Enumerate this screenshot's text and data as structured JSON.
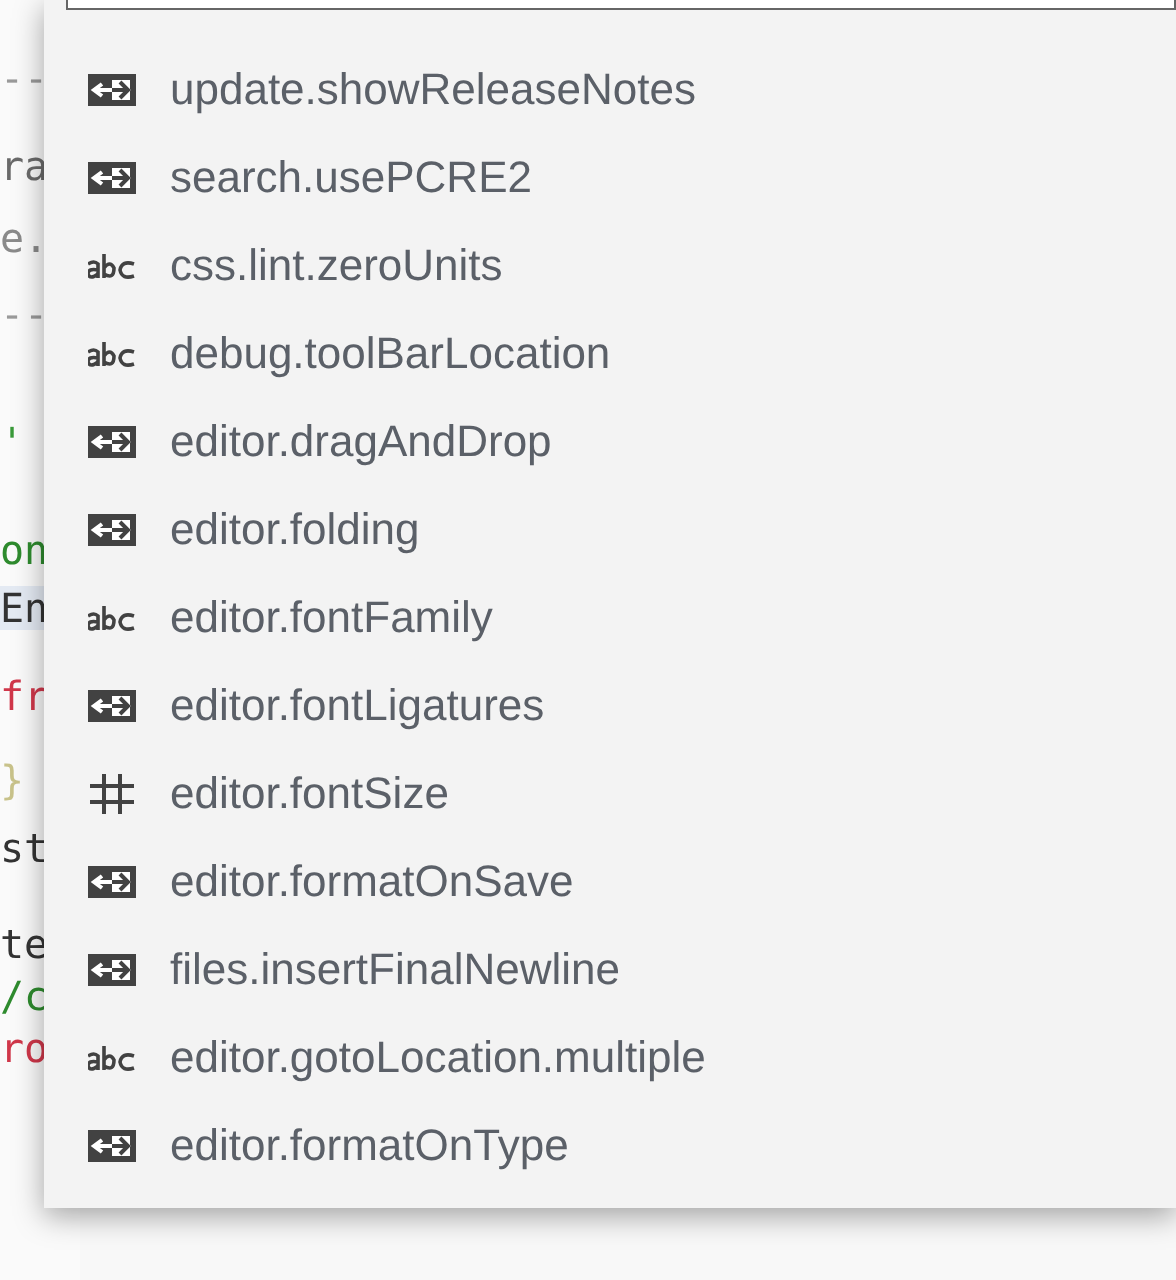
{
  "editor_lines": [
    {
      "text": "--",
      "color": "#9a9a9a"
    },
    {
      "text": "ra",
      "color": "#6a6a6a"
    },
    {
      "text": "e.",
      "color": "#8a8a8a"
    },
    {
      "text": "--",
      "color": "#9a9a9a"
    },
    {
      "text": "'",
      "color": "#3a9a3a"
    },
    {
      "text": "on",
      "color": "#2e8b2e"
    },
    {
      "text": "En",
      "color": "#333333",
      "selected": true
    },
    {
      "text": "fr",
      "color": "#d0374a",
      "selected": false
    },
    {
      "text": "}",
      "color": "#c8c28a"
    },
    {
      "text": "st",
      "color": "#333333"
    },
    {
      "text": "te",
      "color": "#333333"
    },
    {
      "text": "/c",
      "color": "#2e8b2e"
    },
    {
      "text": "ro",
      "color": "#d0374a"
    }
  ],
  "suggestions": [
    {
      "kind": "enum",
      "label": "update.showReleaseNotes"
    },
    {
      "kind": "enum",
      "label": "search.usePCRE2"
    },
    {
      "kind": "string",
      "label": "css.lint.zeroUnits"
    },
    {
      "kind": "string",
      "label": "debug.toolBarLocation"
    },
    {
      "kind": "enum",
      "label": "editor.dragAndDrop"
    },
    {
      "kind": "enum",
      "label": "editor.folding"
    },
    {
      "kind": "string",
      "label": "editor.fontFamily"
    },
    {
      "kind": "enum",
      "label": "editor.fontLigatures"
    },
    {
      "kind": "number",
      "label": "editor.fontSize"
    },
    {
      "kind": "enum",
      "label": "editor.formatOnSave"
    },
    {
      "kind": "enum",
      "label": "files.insertFinalNewline"
    },
    {
      "kind": "string",
      "label": "editor.gotoLocation.multiple"
    },
    {
      "kind": "enum",
      "label": "editor.formatOnType"
    }
  ]
}
